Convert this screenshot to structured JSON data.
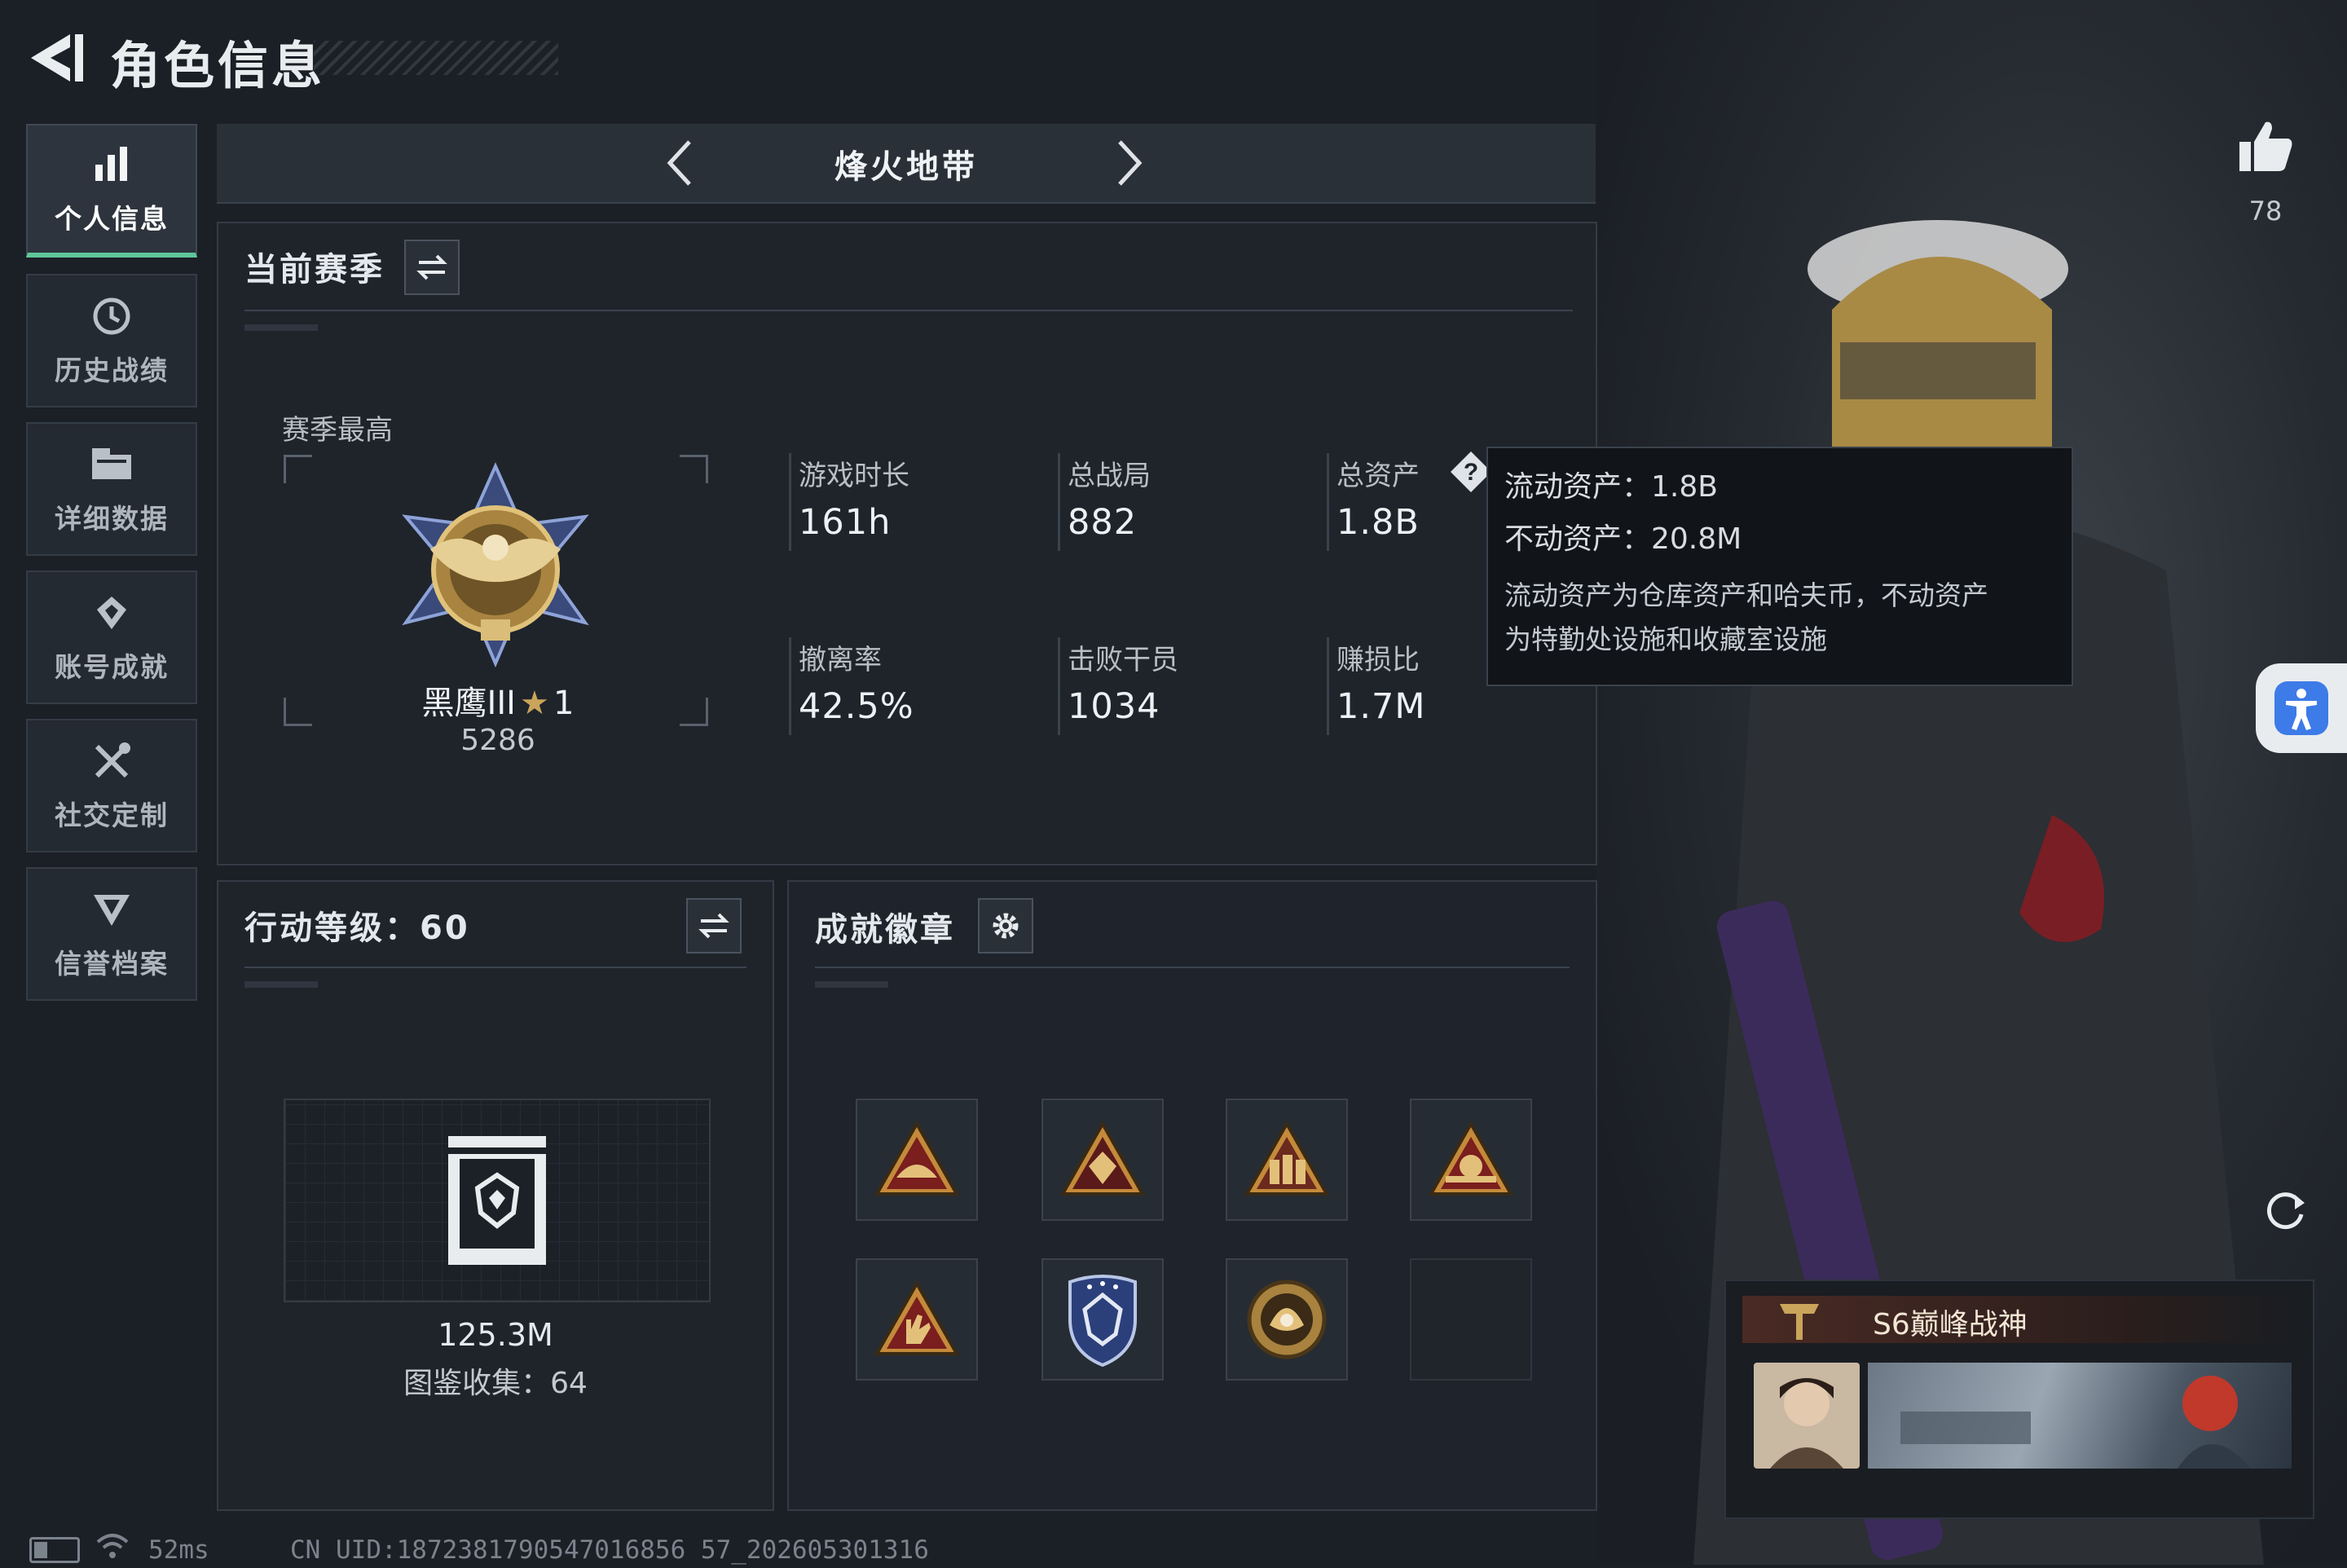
{
  "header": {
    "title": "角色信息"
  },
  "sidebar": {
    "items": [
      {
        "label": "个人信息",
        "icon": "bar-chart-icon",
        "active": true
      },
      {
        "label": "历史战绩",
        "icon": "history-clock-icon"
      },
      {
        "label": "详细数据",
        "icon": "folder-icon"
      },
      {
        "label": "账号成就",
        "icon": "achievement-diamond-icon"
      },
      {
        "label": "社交定制",
        "icon": "tools-icon"
      },
      {
        "label": "信誉档案",
        "icon": "shield-v-icon"
      }
    ]
  },
  "mode_bar": {
    "title": "烽火地带"
  },
  "season": {
    "title": "当前赛季",
    "best_label": "赛季最高",
    "rank_name": "黑鹰III",
    "rank_stars": "1",
    "rank_points": "5286",
    "stats": [
      {
        "label": "游戏时长",
        "value": "161h"
      },
      {
        "label": "总战局",
        "value": "882"
      },
      {
        "label": "总资产",
        "value": "1.8B"
      },
      {
        "label": "撤离率",
        "value": "42.5%"
      },
      {
        "label": "击败干员",
        "value": "1034"
      },
      {
        "label": "赚损比",
        "value": "1.7M"
      }
    ]
  },
  "tooltip": {
    "liquid": "流动资产：1.8B",
    "fixed": "不动资产：20.8M",
    "desc_line1": "流动资产为仓库资产和哈夫币，不动资产",
    "desc_line2": "为特勤处设施和收藏室设施"
  },
  "action_level": {
    "title": "行动等级：60",
    "value": "125.3M",
    "collection": "图鉴收集：64"
  },
  "badges": {
    "title": "成就徽章",
    "items": [
      "triangle-helmet-badge",
      "triangle-skull-badge",
      "triangle-soldiers-badge",
      "triangle-55-badge",
      "triangle-hand-badge",
      "shield-eagle-badge",
      "round-pearl-badge",
      "empty"
    ]
  },
  "profile": {
    "likes": "78",
    "card_title": "S6巅峰战神"
  },
  "footer": {
    "ping": "52ms",
    "uid": "CN UID:1872381790547016856 57_202605301316"
  },
  "colors": {
    "accent": "#5fc79a",
    "accessibility": "#3d7be8",
    "gold": "#c9a45a"
  }
}
